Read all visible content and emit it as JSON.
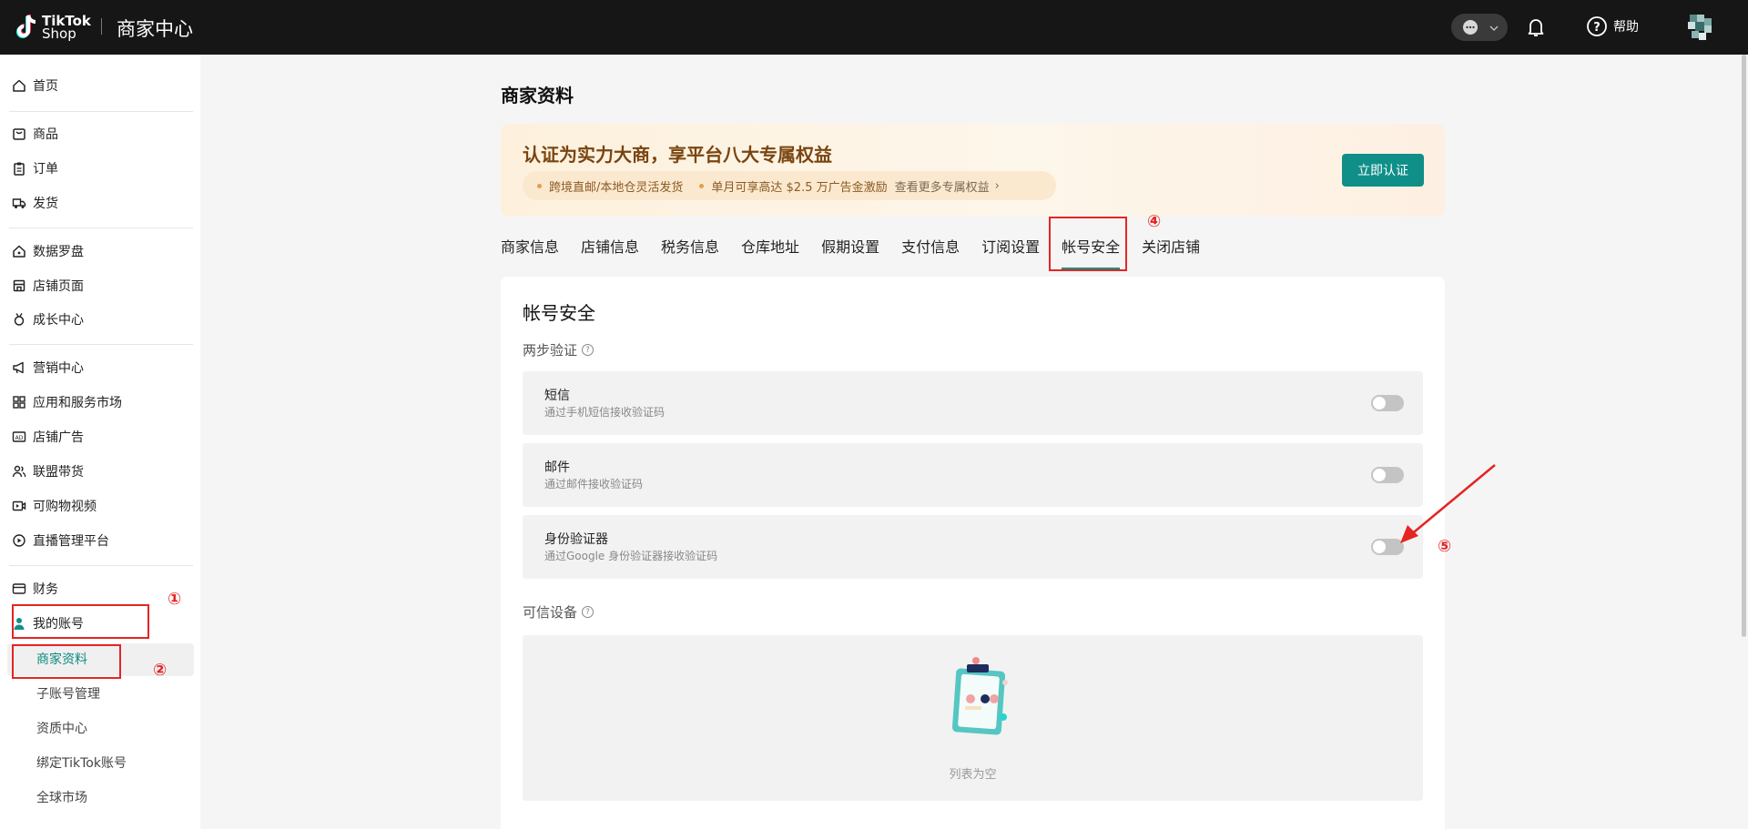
{
  "header": {
    "logo_line1": "TikTok",
    "logo_line2": "Shop",
    "title": "商家中心",
    "help_label": "帮助"
  },
  "sidebar": {
    "items": [
      {
        "label": "首页"
      },
      {
        "label": "商品"
      },
      {
        "label": "订单"
      },
      {
        "label": "发货"
      },
      {
        "label": "数据罗盘"
      },
      {
        "label": "店铺页面"
      },
      {
        "label": "成长中心"
      },
      {
        "label": "营销中心"
      },
      {
        "label": "应用和服务市场"
      },
      {
        "label": "店铺广告"
      },
      {
        "label": "联盟带货"
      },
      {
        "label": "可购物视频"
      },
      {
        "label": "直播管理平台"
      },
      {
        "label": "财务"
      },
      {
        "label": "我的账号"
      }
    ],
    "subitems": [
      {
        "label": "商家资料"
      },
      {
        "label": "子账号管理"
      },
      {
        "label": "资质中心"
      },
      {
        "label": "绑定TikTok账号"
      },
      {
        "label": "全球市场"
      }
    ]
  },
  "main": {
    "page_title": "商家资料",
    "banner": {
      "title": "认证为实力大商，享平台八大专属权益",
      "perk1": "跨境直邮/本地仓灵活发货",
      "perk2": "单月可享高达 $2.5 万广告金激励",
      "more": "查看更多专属权益",
      "button": "立即认证"
    },
    "tabs": [
      {
        "label": "商家信息"
      },
      {
        "label": "店铺信息"
      },
      {
        "label": "税务信息"
      },
      {
        "label": "仓库地址"
      },
      {
        "label": "假期设置"
      },
      {
        "label": "支付信息"
      },
      {
        "label": "订阅设置"
      },
      {
        "label": "帐号安全"
      },
      {
        "label": "关闭店铺"
      }
    ],
    "card": {
      "title": "帐号安全",
      "two_step_label": "两步验证",
      "methods": [
        {
          "title": "短信",
          "desc": "通过手机短信接收验证码",
          "enabled": false
        },
        {
          "title": "邮件",
          "desc": "通过邮件接收验证码",
          "enabled": false
        },
        {
          "title": "身份验证器",
          "desc": "通过Google 身份验证器接收验证码",
          "enabled": false
        }
      ],
      "trusted_label": "可信设备",
      "empty_text": "列表为空"
    }
  },
  "annotations": [
    "①",
    "②",
    "④",
    "⑤"
  ],
  "colors": {
    "accent": "#0f8f88",
    "annotation": "#e52424"
  }
}
